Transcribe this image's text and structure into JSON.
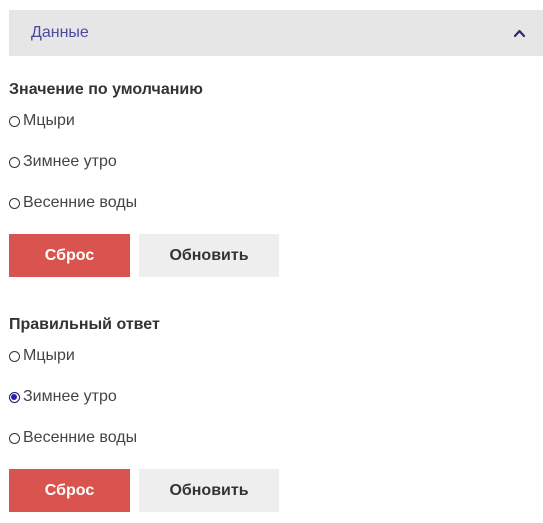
{
  "panel": {
    "title": "Данные",
    "toggle_icon": "chevron-up-icon"
  },
  "default_value": {
    "title": "Значение по умолчанию",
    "options": [
      {
        "label": "Мцыри",
        "selected": false
      },
      {
        "label": "Зимнее утро",
        "selected": false
      },
      {
        "label": "Весенние воды",
        "selected": false
      }
    ],
    "reset_label": "Сброс",
    "update_label": "Обновить"
  },
  "correct_answer": {
    "title": "Правильный ответ",
    "options": [
      {
        "label": "Мцыри",
        "selected": false
      },
      {
        "label": "Зимнее утро",
        "selected": true
      },
      {
        "label": "Весенние воды",
        "selected": false
      }
    ],
    "reset_label": "Сброс",
    "update_label": "Обновить"
  },
  "colors": {
    "header_bg": "#e6e6e6",
    "header_text": "#4a4a9c",
    "reset_button": "#d9534f",
    "update_button": "#eeeeee",
    "selected_radio": "#2a1fb0"
  }
}
